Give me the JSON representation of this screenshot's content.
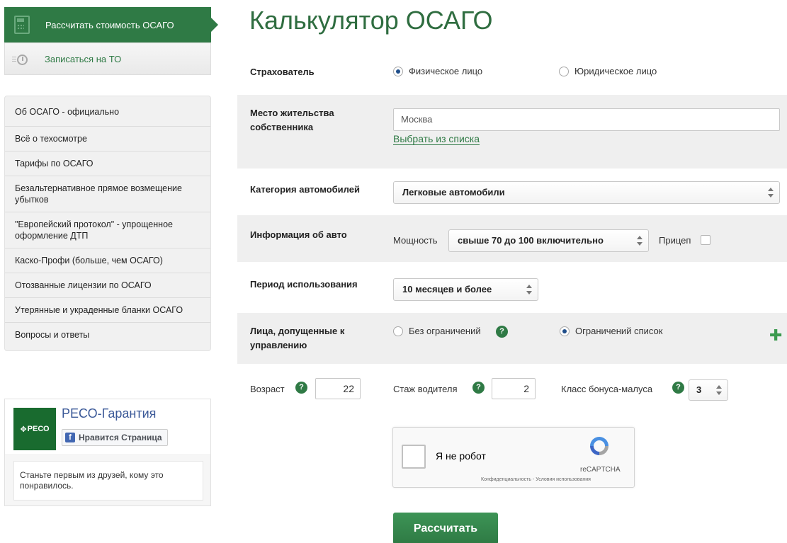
{
  "nav": {
    "primary_label": "Рассчитать стоимость ОСАГО",
    "secondary_label": "Записаться на ТО"
  },
  "side_menu": [
    "Об ОСАГО - официально",
    "Всё о техосмотре",
    "Тарифы по ОСАГО",
    "Безальтернативное прямое возмещение убытков",
    "\"Европейский протокол\" - упрощенное оформление ДТП",
    "Каско-Профи (больше, чем ОСАГО)",
    "Отозванные лицензии по ОСАГО",
    "Утерянные и украденные бланки ОСАГО",
    "Вопросы и ответы"
  ],
  "fb_widget": {
    "logo_text": "РЕСО",
    "page_name": "РЕСО-Гарантия",
    "like_button": "Нравится Страница",
    "friends_text": "Станьте первым из друзей, кому это понравилось."
  },
  "form": {
    "title": "Калькулятор ОСАГО",
    "insurer": {
      "label": "Страхователь",
      "options": [
        "Физическое лицо",
        "Юридическое лицо"
      ],
      "selected": "Физическое лицо"
    },
    "residence": {
      "label": "Место жительства собственника",
      "value": "Москва",
      "choose_link": "Выбрать из списка"
    },
    "category": {
      "label": "Категория автомобилей",
      "selected": "Легковые автомобили"
    },
    "vehicle": {
      "label": "Информация об авто",
      "power_label": "Мощность",
      "power_selected": "свыше 70 до 100 включительно",
      "trailer_label": "Прицеп",
      "trailer_checked": false
    },
    "period": {
      "label": "Период использования",
      "selected": "10 месяцев и более"
    },
    "drivers": {
      "label": "Лица, допущенные к управлению",
      "options": [
        "Без ограничений",
        "Ограничений список"
      ],
      "selected": "Ограничений список"
    },
    "driver_row": {
      "age_label": "Возраст",
      "age_value": "22",
      "experience_label": "Стаж водителя",
      "experience_value": "2",
      "bonus_label": "Класс бонуса-малуса",
      "bonus_value": "3"
    },
    "captcha": {
      "label": "Я не робот",
      "brand": "reCAPTCHA",
      "terms": "Конфиденциальность - Условия использования"
    },
    "submit_label": "Рассчитать"
  },
  "colors": {
    "brand_green": "#2f7a45",
    "title_green": "#2f6d40",
    "shaded_row": "#efefef"
  }
}
